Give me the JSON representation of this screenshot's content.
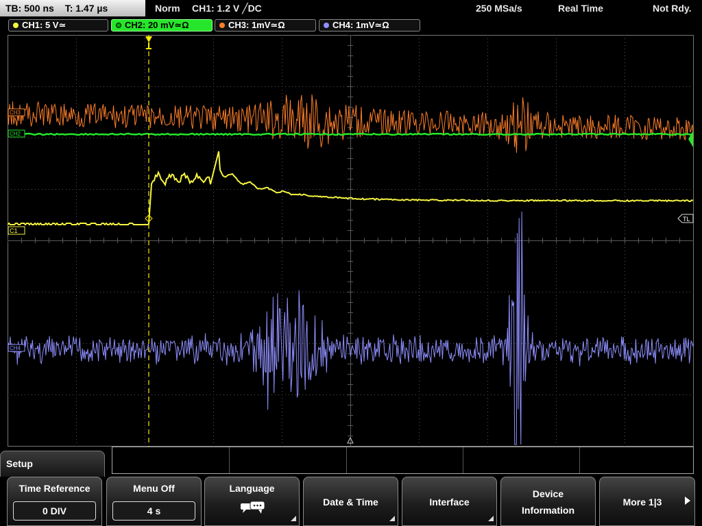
{
  "status_bar": {
    "timebase": "TB: 500 ns",
    "trigger_time": "T: 1.47 µs",
    "acq_mode": "Norm",
    "trigger_info": "CH1: 1.2 V ╱DC",
    "sample_rate": "250 MSa/s",
    "mode": "Real Time",
    "status": "Not Rdy."
  },
  "channels": [
    {
      "label": "CH1: 5 V≃",
      "color": "#f5f542",
      "active": false
    },
    {
      "label": "CH2: 20 mV≃Ω",
      "color": "#25e62a",
      "active": true
    },
    {
      "label": "CH3: 1mV≃Ω",
      "color": "#ff7f2a",
      "active": false
    },
    {
      "label": "CH4: 1mV≃Ω",
      "color": "#8f8fff",
      "active": false
    }
  ],
  "markers": {
    "ch3": "CH3",
    "ch2": "CH2",
    "ch1": "C1",
    "ch4": "CH4",
    "trigger_level": "TL"
  },
  "colors": {
    "ch1": "#f5f542",
    "ch2": "#25e62a",
    "ch3": "#ff7f2a",
    "ch4": "#8f8fff",
    "grid": "#5a5a5a",
    "trigger": "#ffee00"
  },
  "menu": {
    "title": "Setup",
    "softkeys": [
      {
        "label": "Time Reference",
        "value": "0 DIV"
      },
      {
        "label": "Menu Off",
        "value": "4 s"
      },
      {
        "label": "Language",
        "icon": "speech-bubbles-icon"
      },
      {
        "label": "Date & Time"
      },
      {
        "label": "Interface"
      },
      {
        "label_line1": "Device",
        "label_line2": "Information"
      },
      {
        "label": "More 1|3",
        "icon": "arrow-right-icon"
      }
    ]
  }
}
